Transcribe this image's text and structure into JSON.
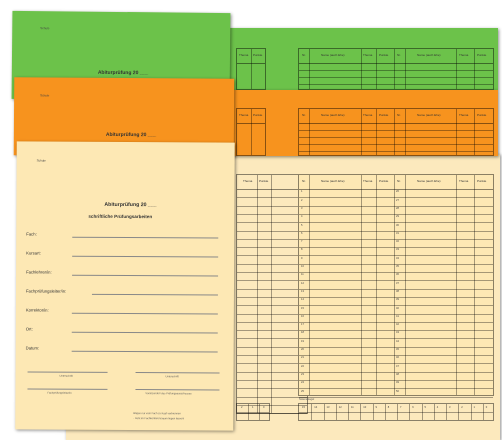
{
  "colors": {
    "green": "#6cc24a",
    "orange": "#f7931e",
    "cream": "#fde8b4",
    "cream_back": "#fce9bd"
  },
  "cover": {
    "logo_text": "Schule",
    "title": "Abiturprüfung 20 ___",
    "subtitle": "schriftliche Prüfungsarbeiten",
    "fields": [
      "Fach:",
      "Kursart:",
      "Fachlehrer/in:",
      "Fachprüfungsleiter/in:",
      "Korrektor/in:",
      "Ort:",
      "Datum:"
    ],
    "signature_left": "Unterschrift",
    "signature_right": "Unterschrift",
    "sig2_left": "Fachprüfungsleiter/in",
    "sig2_right": "Vorsitzende/r des Prüfungsausschusses",
    "footer_line1": "Bögen nur vom Fach zu Kopf verbrennen",
    "footer_line2": "- nicht im Fachkonferenzraum liegen lassen!"
  },
  "orange_sheet": {
    "logo_text": "Schule",
    "title": "Abiturprüfung 20 ___"
  },
  "green_sheet": {
    "logo_text": "Schule",
    "title": "Abiturprüfung 20 ___"
  },
  "table_headers": {
    "nr": "Nr.",
    "name": "Name (auch Ehe)",
    "thema": "Thema",
    "punkte": "Punkte"
  },
  "table_headers_left": {
    "thema": "Thema",
    "punkte": "Punkte"
  },
  "row_numbers_left": [
    "1",
    "2",
    "3",
    "4",
    "5",
    "6",
    "7",
    "8",
    "9",
    "10",
    "11",
    "12",
    "13",
    "14",
    "15",
    "16",
    "17",
    "18",
    "19",
    "20",
    "21",
    "22",
    "23",
    "24",
    "25"
  ],
  "row_numbers_right": [
    "26",
    "27",
    "28",
    "29",
    "30",
    "31",
    "32",
    "33",
    "34",
    "35",
    "36",
    "37",
    "38",
    "39",
    "40",
    "41",
    "42",
    "43",
    "44",
    "45",
    "46",
    "47",
    "48",
    "49",
    "50"
  ],
  "notenspiegel": {
    "label": "Notenspiegel",
    "scale_left": [
      "15",
      "14",
      "13",
      "12",
      "11",
      "10",
      "9",
      "8",
      "7",
      "6",
      "5",
      "4",
      "3",
      "2",
      "1",
      "0"
    ],
    "scale_bottom_left": [
      "2",
      "1",
      "0"
    ]
  }
}
